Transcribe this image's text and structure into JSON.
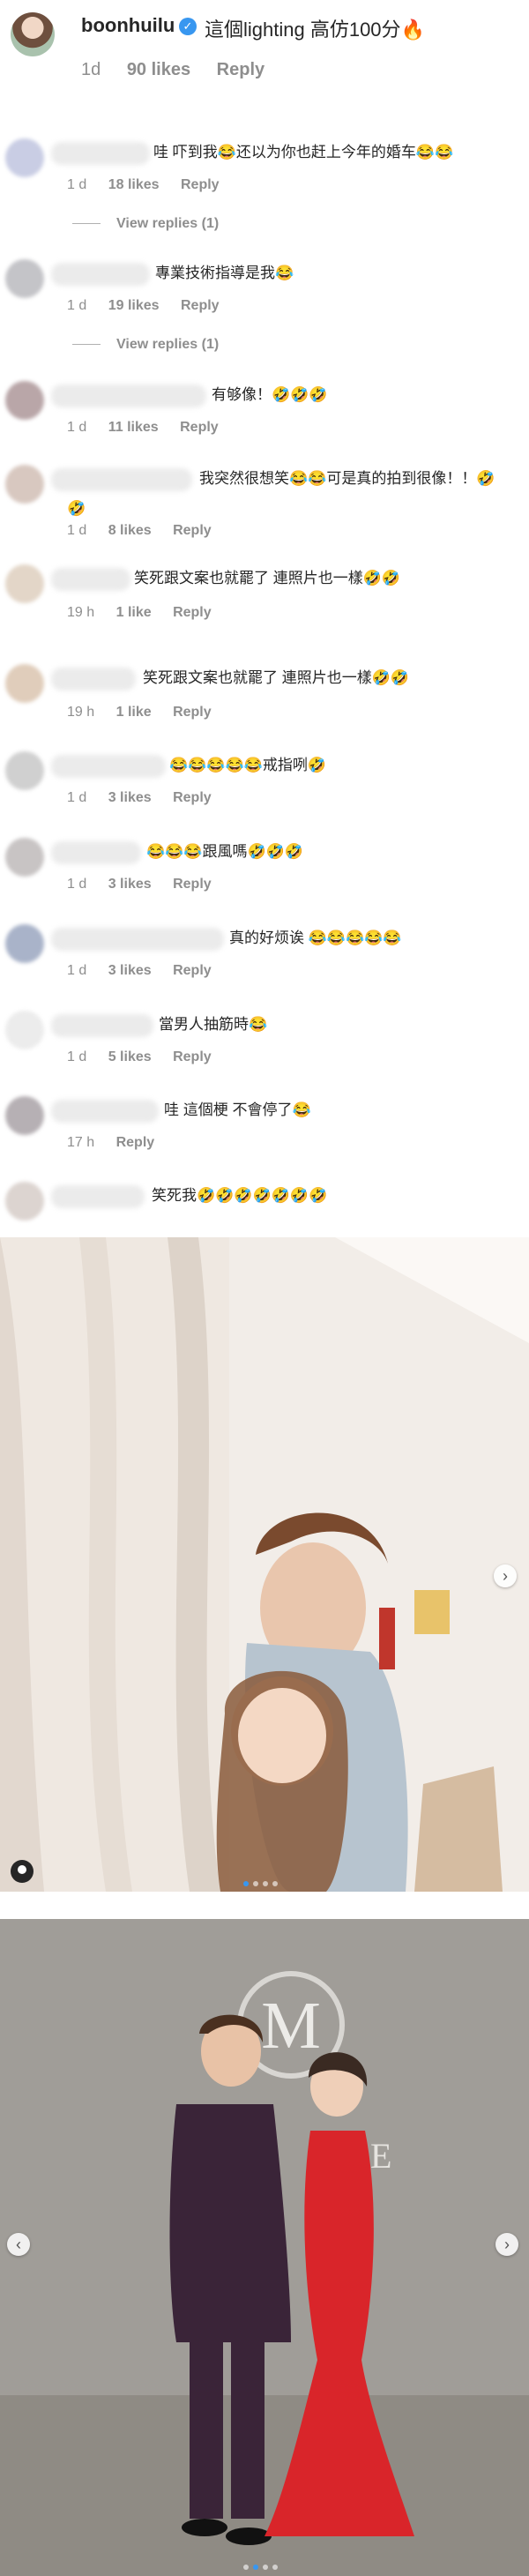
{
  "post_comment": {
    "username": "boonhuilu",
    "verified_icon": "check-icon",
    "text": "這個lighting 高仿100分🔥",
    "time": "1d",
    "likes": "90 likes",
    "reply_label": "Reply"
  },
  "comments": [
    {
      "text": "哇 吓到我😂还以为你也赶上今年的婚车😂😂",
      "time": "1 d",
      "likes": "18 likes",
      "reply": "Reply",
      "view_replies": "View replies (1)"
    },
    {
      "text": "專業技術指導是我😂",
      "time": "1 d",
      "likes": "19 likes",
      "reply": "Reply",
      "view_replies": "View replies (1)"
    },
    {
      "text": "有够像！🤣🤣🤣",
      "time": "1 d",
      "likes": "11 likes",
      "reply": "Reply"
    },
    {
      "text": "我突然很想笑😂😂可是真的拍到很像！！🤣",
      "text2": "🤣",
      "time": "1 d",
      "likes": "8 likes",
      "reply": "Reply"
    },
    {
      "text": "笑死跟文案也就罷了 連照片也一樣🤣🤣",
      "time": "19 h",
      "likes": "1 like",
      "reply": "Reply"
    },
    {
      "text": "笑死跟文案也就罷了 連照片也一樣🤣🤣",
      "time": "19 h",
      "likes": "1 like",
      "reply": "Reply"
    },
    {
      "text": "😂😂😂😂😂戒指咧🤣",
      "time": "1 d",
      "likes": "3 likes",
      "reply": "Reply"
    },
    {
      "text": "😂😂😂跟風嗎🤣🤣🤣",
      "time": "1 d",
      "likes": "3 likes",
      "reply": "Reply"
    },
    {
      "text": "真的好烦诶 😂😂😂😂😂",
      "time": "1 d",
      "likes": "3 likes",
      "reply": "Reply"
    },
    {
      "text": "當男人抽筋時😂",
      "time": "1 d",
      "likes": "5 likes",
      "reply": "Reply"
    },
    {
      "text": "哇 這個梗 不會停了😂",
      "time": "17 h",
      "reply": "Reply"
    },
    {
      "text": "笑死我🤣🤣🤣🤣🤣🤣🤣"
    }
  ],
  "photos": {
    "photo1_icons": [
      "user-tag-icon",
      "chevron-right-icon"
    ],
    "photo2_icons": [
      "chevron-left-icon",
      "chevron-right-icon"
    ],
    "logo_letters": "M",
    "logo_side_letter": "E"
  }
}
